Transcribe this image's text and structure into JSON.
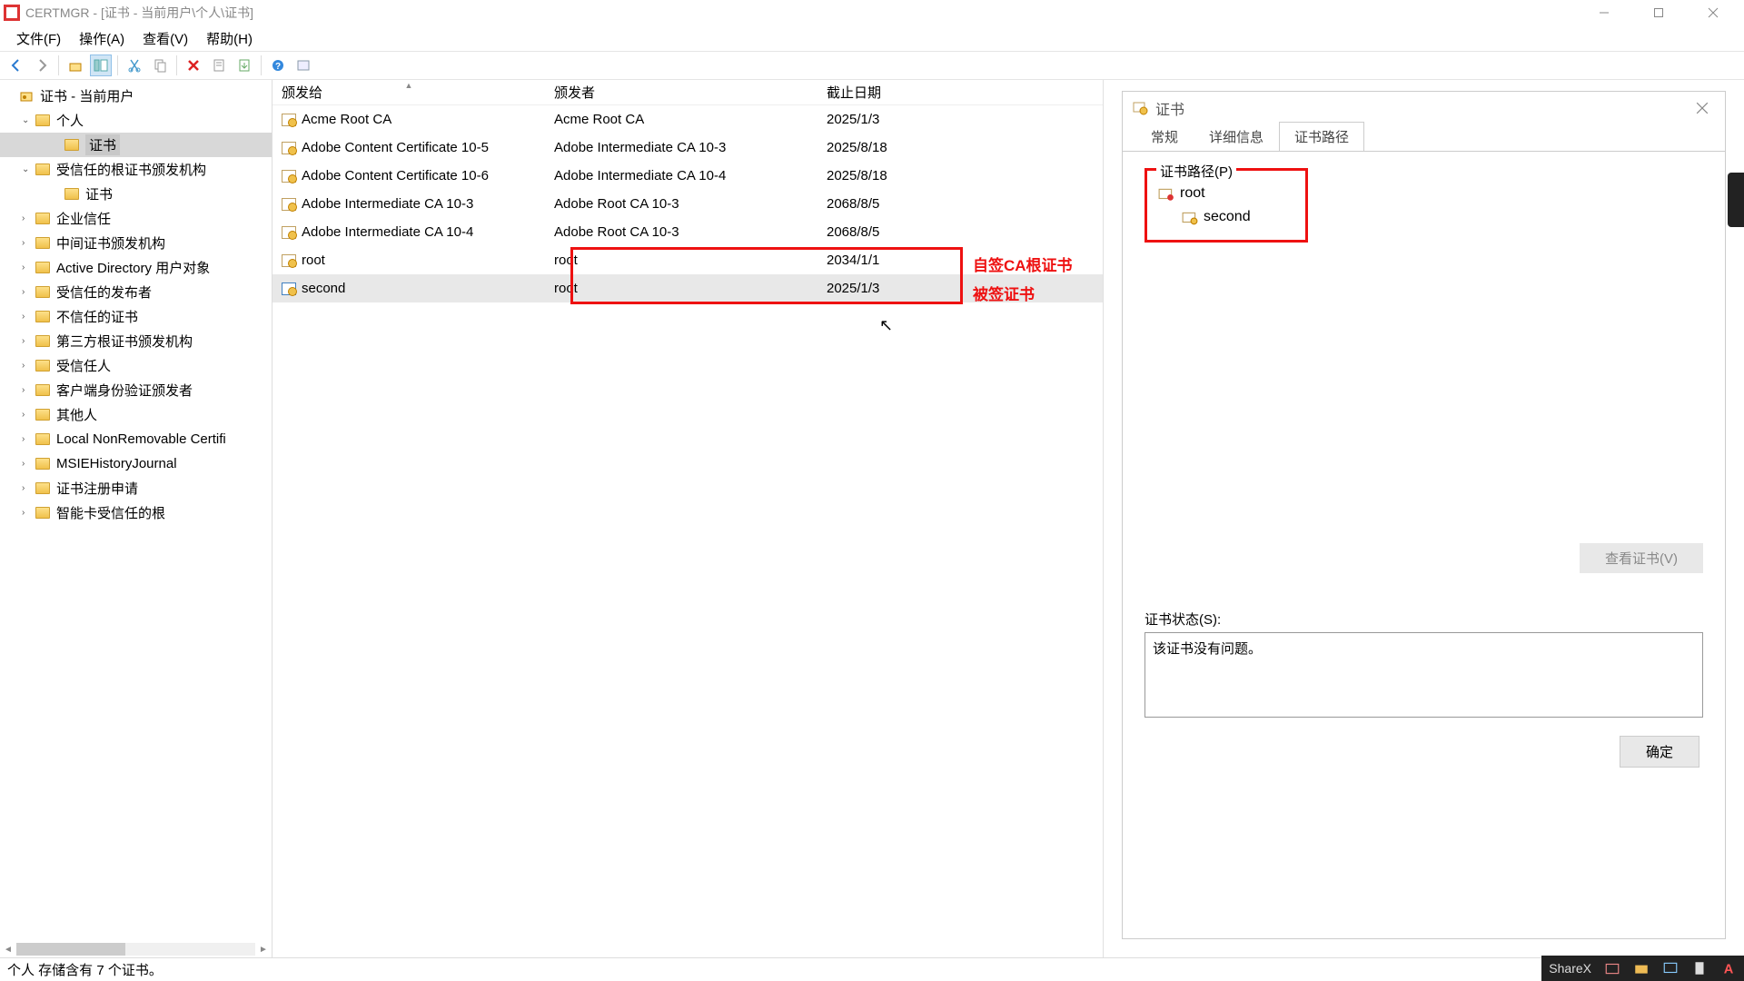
{
  "window": {
    "title": "CERTMGR - [证书 - 当前用户\\个人\\证书]"
  },
  "menu": {
    "file": "文件(F)",
    "action": "操作(A)",
    "view": "查看(V)",
    "help": "帮助(H)"
  },
  "tree": {
    "root": "证书 - 当前用户",
    "items": [
      {
        "label": "个人",
        "expanded": true,
        "children": [
          {
            "label": "证书",
            "selected": true
          }
        ]
      },
      {
        "label": "受信任的根证书颁发机构",
        "expanded": true,
        "children": [
          {
            "label": "证书"
          }
        ]
      },
      {
        "label": "企业信任"
      },
      {
        "label": "中间证书颁发机构"
      },
      {
        "label": "Active Directory 用户对象"
      },
      {
        "label": "受信任的发布者"
      },
      {
        "label": "不信任的证书"
      },
      {
        "label": "第三方根证书颁发机构"
      },
      {
        "label": "受信任人"
      },
      {
        "label": "客户端身份验证颁发者"
      },
      {
        "label": "其他人"
      },
      {
        "label": "Local NonRemovable Certifi"
      },
      {
        "label": "MSIEHistoryJournal"
      },
      {
        "label": "证书注册申请"
      },
      {
        "label": "智能卡受信任的根"
      }
    ]
  },
  "list": {
    "columns": {
      "issued_to": "颁发给",
      "issuer": "颁发者",
      "expiry": "截止日期"
    },
    "rows": [
      {
        "issued_to": "Acme Root CA",
        "issuer": "Acme Root CA",
        "expiry": "2025/1/3"
      },
      {
        "issued_to": "Adobe Content Certificate 10-5",
        "issuer": "Adobe Intermediate CA 10-3",
        "expiry": "2025/8/18"
      },
      {
        "issued_to": "Adobe Content Certificate 10-6",
        "issuer": "Adobe Intermediate CA 10-4",
        "expiry": "2025/8/18"
      },
      {
        "issued_to": "Adobe Intermediate CA 10-3",
        "issuer": "Adobe Root CA 10-3",
        "expiry": "2068/8/5"
      },
      {
        "issued_to": "Adobe Intermediate CA 10-4",
        "issuer": "Adobe Root CA 10-3",
        "expiry": "2068/8/5"
      },
      {
        "issued_to": "root",
        "issuer": "root",
        "expiry": "2034/1/1"
      },
      {
        "issued_to": "second",
        "issuer": "root",
        "expiry": "2025/1/3",
        "selected": true
      }
    ],
    "annotations": {
      "root_label": "自签CA根证书",
      "second_label": "被签证书"
    }
  },
  "dialog": {
    "title": "证书",
    "tabs": {
      "general": "常规",
      "details": "详细信息",
      "path": "证书路径"
    },
    "path_label": "证书路径(P)",
    "path_tree": {
      "root": "root",
      "child": "second"
    },
    "view_cert": "查看证书(V)",
    "status_label": "证书状态(S):",
    "status_text": "该证书没有问题。",
    "ok": "确定"
  },
  "statusbar": "个人 存储含有 7 个证书。",
  "sharex": {
    "label": "ShareX"
  }
}
